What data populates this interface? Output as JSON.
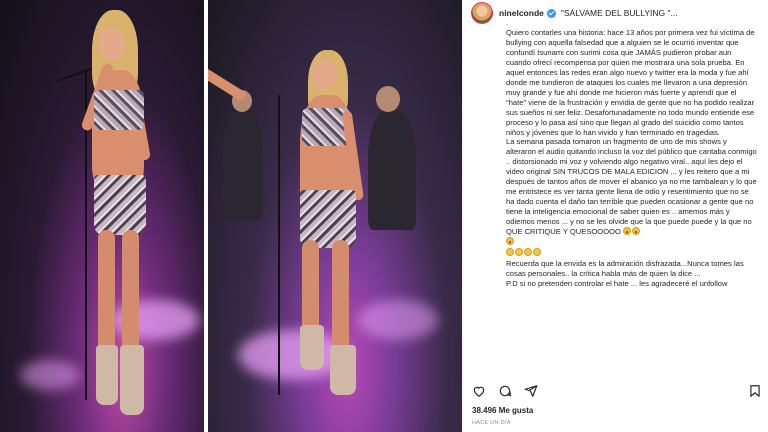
{
  "post": {
    "username": "ninelconde",
    "title": "\"SÁLVAME DEL BULLYING \"...",
    "caption_paragraphs": [
      "Quiero contarles una historia: hace 13 años por primera vez fui víctima de bullying con aquella falsedad que a alguien se le ocurrió inventar que confundí tsunami con surimi cosa que JAMÁS pudieron probar aun cuando ofrecí recompensa por quien me mostrara una sola prueba. En aquel entonces las redes eran algo nuevo y twitter era la moda y fue ahí donde me tundieron de ataques los cuales me llevaron a una depresión muy grande y fue ahí donde me hicieron más fuerte y aprendí que el \"hate\" viene de la frustración y envidia de gente que no ha podido realizar sus sueños ni ser feliz. Desafortunadamente no todo mundo entiende ese proceso y lo pasa así sino que llegan al grado del suicidio como tantos niños y jóvenes que lo han vivido y han terminado en tragedias.",
      "La semana pasada tomaron un fragmento de uno de mis shows y alteraron el audio quitando incluso la voz del público que cantaba conmigo .. distorsionado mi voz y volviendo algo negativo viral.. aquí les dejo el video original SIN TRUCOS DE MALA EDICION ... y les reitero que a mi después de tantos años de mover el abanico ya no me tambalean y lo que me entristece es ver tanta gente llena de odio y resentimiento que no se ha dado cuenta el daño tan terrible que pueden ocasionar a gente que no tiene la inteligencia emocional de saber quien es .. amemos más y odiemos menos ... y no se les olvide que la que puede puede y la que no QUE CRITIQUE Y QUESOOOOO",
      "Recuerda que la envida es la admiración disfrazada...Nunca tomes las cosas personales.. la crítica habla más de quien la dice ...",
      "P.D si no pretenden controlar el hate ... les agradeceré el unfollow"
    ],
    "likes": "38.496 Me gusta",
    "time_ago": "HACE UN DÍA"
  },
  "icons": {
    "verified": "verified-badge-icon",
    "like": "heart-icon",
    "comment": "comment-icon",
    "share": "share-icon",
    "save": "bookmark-icon",
    "emoji_grin": "grinning-face-icon",
    "emoji_laugh": "laughing-face-icon"
  },
  "colors": {
    "verified_blue": "#3897f0",
    "text": "#262626",
    "muted": "#8e8e8e"
  }
}
